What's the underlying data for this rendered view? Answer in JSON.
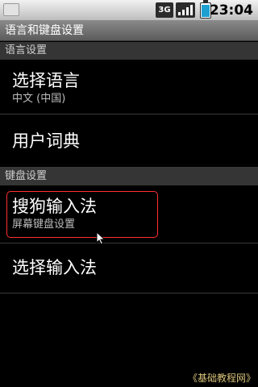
{
  "status_bar": {
    "network_label": "3G",
    "time": "23:04",
    "icons": [
      "notification-app-icon",
      "3g-network-icon",
      "signal-strength-icon",
      "battery-icon"
    ]
  },
  "title_bar": {
    "title": "语言和键盘设置"
  },
  "sections": [
    {
      "header": "语言设置"
    },
    {
      "header": "键盘设置"
    }
  ],
  "items": {
    "select_language": {
      "title": "选择语言",
      "summary": "中文 (中国)"
    },
    "user_dictionary": {
      "title": "用户词典"
    },
    "sogou_input": {
      "title": "搜狗输入法",
      "summary": "屏幕键盘设置"
    },
    "select_input_method": {
      "title": "选择输入法"
    }
  },
  "colors": {
    "focus_ring": "#ff3030",
    "battery": "#1e9fd1",
    "section_header_bg": "#353535",
    "watermark": "#d9c27a"
  },
  "watermark": "《基础教程网》"
}
